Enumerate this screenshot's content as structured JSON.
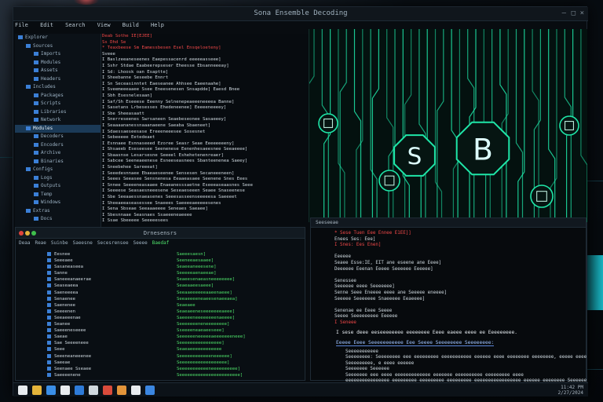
{
  "window": {
    "title": "Sona Ensemble Decoding"
  },
  "menu": [
    "File",
    "Edit",
    "Search",
    "View",
    "Build",
    "Help"
  ],
  "tree_rows": [
    "Explorer",
    "Sources",
    "Imports",
    "Modules",
    "Assets",
    "Headers",
    "Includes",
    "Packages",
    "Scripts",
    "Libraries",
    "Network",
    "Modules",
    "Decoders",
    "Encoders",
    "Archive",
    "Binaries",
    "Configs",
    "Logs",
    "Outputs",
    "Temp",
    "Windows",
    "Extras",
    "Docs"
  ],
  "tree_selected_index": 11,
  "editor_lines": [
    "Deab Sothe IE[EJEE]",
    "  Ss Dhd Se",
    "  * Teaxbeese Sm Eamessbesen Esel Ensqeloeteny]",
    "    Sveee",
    "    I Baslzeeaneseenes Eaepessacenrd eeeeeasseee]",
    "    I Sshr Stdae Eaabeerepseser Eheesse Ebsanneeeay]",
    "    I Sd: Lhoosk oan Esaptte]",
    "    I Sheebanne Seseebe Ennrt",
    "    I Sn Seceasinntet Eaeseanee Ahhsee Eaeenaahe]",
    "    I Sveemeeeaaee Ssee Eneesenesen Snsapdde] Eaesd Bnee",
    "    I Sbh Esesnelesaan]",
    "    I Saf/Sh Eseeese Eeenny Selnenepeaeeeneeeea Banne]",
    "    I Sasetans Lrbesesses Ehedeneenee] Eeeeeneeeey]",
    "    I Sbe Sheeasaatt",
    "    I Snerreseenes Swrsaneen Seaebeseonee Sasaeeey]",
    "    I Seaaaananessnaaanaeene Saeaba Sbaeneet]",
    "    I Sdaessaeseesase Ereeeneeesee Sosesnet",
    "    I Sebeeeee Eetedeaet",
    "    I Esnnaee Esnnaseeed Ezoree Seasr Seae Eeeeeeeeny]",
    "    I Shsaeeb Eseseesee Seenenese Eenenhesaeesnee Seeaeeee]",
    "    I Sbaasnse Lesarsesne Seeeel Eshehetenenreaer]",
    "    I Sabcee Seeneaeenese Esneeseasnees Sbanteenenea Saeey]",
    "    I Sneebehee Sareeeat]",
    "    I Seeedesnnaee Ebaeaeseenee Sensesen Secaneeeneen]",
    "    I Seees Seeasee Sensnenesa Eeaaeasaee Seenene Snes Eees",
    "    I Snnee Seeeeneasaaee Enaeanesssaetne Eseeeaseaasnes Seee",
    "    I Seeeese Seasaesneeesene Seseaeseeen Seaee Snaseenese",
    "    I Sbe Seeaaessnaeasenes Seeesasseenseeeeesa Saeeeet",
    "    I Sheeaeeaseasessee Snaeees Saeeeeaeeeeesenes",
    "    I Sena Sbseae Seeaaaeeee Seneaes Saeaee]",
    "    I Sbesnnaae Seasnaes Ssaeeeneaeeee",
    "    I Ssae Sbeeeee Seeeeesees"
  ],
  "terminal": {
    "title": "Drnesensrs",
    "tabs": [
      "Deaa",
      "Reae",
      "Suinbe",
      "Saeesne",
      "Secesrensee",
      "Seeee",
      "Baedaf"
    ],
    "active_tab": 6,
    "names": [
      "Eesnee",
      "Seeeaee",
      "Sasaneaseea",
      "Sanne",
      "Saneeeanaeerae",
      "Seaseaeea",
      "Saeneeeea",
      "Senaenee",
      "Saenenee",
      "Seeeenen",
      "Seeaeeenae",
      "Seanee",
      "Saeeeneseeee",
      "Saeae",
      "Sae Seeeeneee",
      "Seee",
      "Seeeneaneeenee",
      "Saeeae",
      "Seenaee Sseaee",
      "Saeeeenene"
    ],
    "values": [
      "Saeeesaesn]",
      "Seeneeaesaaee]",
      "Seaeeaneeesene]",
      "Seeeeeaenaeeae]",
      "Seaeesenaeasneeeeeeee]",
      "Seaeaaeesaeee]",
      "Seeaaeeeeeeaaeenaeee]",
      "Seeaeeeeneaeesenaeeaea]",
      "Seaeaee",
      "Seaeaeeneseeeeeeeaeee]",
      "Saeeeeneeeeeeeenaeeee]",
      "Seeeeeeeneneeeeeeee]",
      "Sseeeeneaeaeeseee]",
      "Seeeeeeneeeeeaeeeeeeeneee]",
      "Seeeeeeeeeeeeeeee]",
      "Seaeaeeeeeeeeeeee",
      "Seeeeeeeeeeeeneeeeee]",
      "Seeeeeeeeeeeeeeeeee]",
      "Seeeeeeeeeeeneeeeeeeeee]",
      "Seeeeeeeeeeeeeeeeeeeeeee]"
    ]
  },
  "code_panel": {
    "title": "Seeseeae",
    "lines": [
      "  * Sese Tuen Eee Ennee E1EE]]",
      "    Enees Ses: Eee]",
      "    I Snes: Ees Enen]",
      "",
      "    Eeeeee",
      "      Seaee Esse:IE, EIT ane eseene ane Eeee]",
      "      Deeeeee Eeenan Eeeee Seeeeee Eeeeee]",
      "",
      "      Senessee",
      "        Seeeeee eeee Seeeeeee]",
      "        Senne Seee Eneeee eeee ane Seeeee eneeee]",
      "        Seeeee Seeeeeee Snaeeeee Eeaeeee]",
      "",
      "      Senenae ee Eeee Seeee",
      "        Seeee Seeeeeeeee Eeeeee",
      "      I Seneee"
    ],
    "paragraph": "I sese deee eeseeeeeeee eeeeeeee Eeee eaeee eeee ee Eeeeeeeee.",
    "link": "Eeeee Eeee Seeeeeeeeeee Eee Seeee Seeeeeeee Seeeeeeee:",
    "output": [
      "Seeeeeeeeeee",
      "Seeeeeeee: Seeeeeeee eee eeeeeeeee eeeeeeeeeee eeeeee eeee eeeeeeee eeeeeeee, eeeee eeee",
      "Seeeeeeeee, e eeee eeeeee",
      "Seeeeeee Seeeeee",
      "Seeeeeee eee eeee eeeeeeeeeeeee eeeeeee eeeeeeeeee eeeeeeeee eeee",
      "  eeeeeeeeeeeeeeee eeeeeeeee eeeeeeeee eeeeeeeee eeeeeeeeeeeeeeeee eeeeee eeeeeeee Seeeeee",
      "  Seeeeeeee"
    ]
  },
  "taskbar": {
    "icons": [
      "start-icon",
      "folder-icon",
      "terminal-icon",
      "browser-icon",
      "store-icon",
      "chat-icon",
      "video-icon",
      "mail-icon",
      "image-icon",
      "settings-icon"
    ],
    "icon_colors": [
      "#e8ecef",
      "#e4b43a",
      "#3a8ee6",
      "#e8ecef",
      "#2e7bd8",
      "#cfd8de",
      "#d94b3b",
      "#e2943a",
      "#e8ecef",
      "#3b86e0"
    ],
    "tray_time": "11:42 PM",
    "tray_date": "2/27/2024"
  },
  "colors": {
    "accent_green": "#1fe6a8",
    "error_red": "#f04848",
    "terminal_green": "#4ee06a"
  }
}
